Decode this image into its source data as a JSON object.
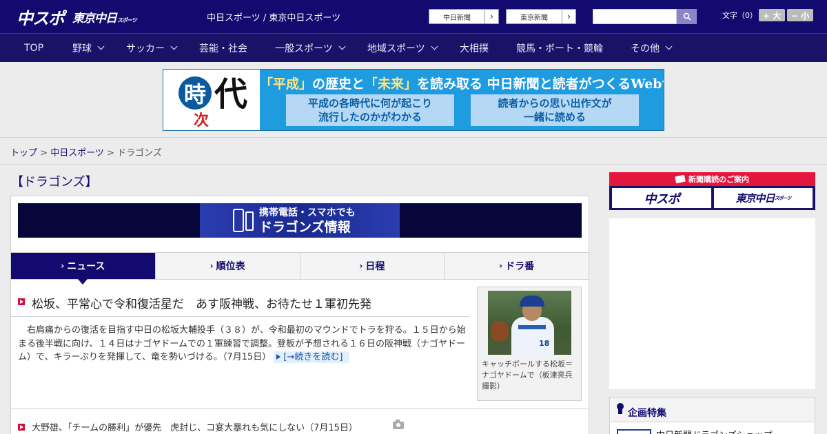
{
  "header": {
    "logo_main": "中スポ",
    "logo_tokyo": "東京中日",
    "logo_tokyo_suffix": "スポーツ",
    "site_title": "中日スポーツ / 東京中日スポーツ",
    "links": [
      "中日新聞",
      "東京新聞"
    ],
    "search_placeholder": "",
    "font_label": "文字（0）",
    "font_bigger": "+ 大",
    "font_smaller": "− 小"
  },
  "nav": [
    {
      "label": "TOP",
      "dropdown": false
    },
    {
      "label": "野球",
      "dropdown": true
    },
    {
      "label": "サッカー",
      "dropdown": true
    },
    {
      "label": "芸能・社会",
      "dropdown": false
    },
    {
      "label": "一般スポーツ",
      "dropdown": true
    },
    {
      "label": "地域スポーツ",
      "dropdown": true
    },
    {
      "label": "大相撲",
      "dropdown": false
    },
    {
      "label": "競馬・ボート・競輪",
      "dropdown": false
    },
    {
      "label": "その他",
      "dropdown": true
    }
  ],
  "banner": {
    "ji": "時",
    "dai": "代",
    "tsugi": "次",
    "headline_parts": [
      "「平成」",
      "の歴史と",
      "「未来」",
      "を読み取る 中日新聞と読者がつくるWebサイト"
    ],
    "box_left": "平成の各時代に何が起こり\n流行したのかがわかる",
    "box_right": "読者からの思い出作文が\n一緒に読める"
  },
  "breadcrumb": {
    "items": [
      "トップ",
      "中日スポーツ",
      "ドラゴンズ"
    ],
    "separator": " > "
  },
  "page_title": "【ドラゴンズ】",
  "mobile_banner": {
    "line1": "携帯電話・スマホでも",
    "line2": "ドラゴンズ情報"
  },
  "tabs": [
    {
      "label": "ニュース",
      "active": true
    },
    {
      "label": "順位表",
      "active": false
    },
    {
      "label": "日程",
      "active": false
    },
    {
      "label": "ドラ番",
      "active": false
    }
  ],
  "lead": {
    "title": "松坂、平常心で令和復活星だ　あす阪神戦、お待たせ１軍初先発",
    "body": "　右肩痛からの復活を目指す中日の松坂大輔投手（３８）が、令和最初のマウンドでトラを狩る。１５日から始まる後半戦に向け、１４日はナゴヤドームでの１軍練習で調整。登板が予想される１６日の阪神戦（ナゴヤドーム）で、キラーぶりを発揮して、竜を勢いづける。（7月15日）",
    "read_more": "[→続きを読む]",
    "photo_caption": "キャッチボールする松坂＝ナゴヤドームで（板津亮兵撮影）",
    "photo_number": "18"
  },
  "news_items": [
    {
      "text": "大野雄、「チームの勝利」が優先　虎封じ、コ宴大暴れも気にしない（7月15日）"
    }
  ],
  "sidebar": {
    "subscribe_title": "新聞購読のご案内",
    "subscribe_logos": [
      "中スポ",
      "東京中日"
    ],
    "subscribe_logo_suffix": "スポーツ",
    "feature_title": "企画特集",
    "feature_item": "中日新聞ドラゴンズショップ"
  },
  "colors": {
    "navy": "#120a6e",
    "accent_red": "#d0103a",
    "banner_blue": "#1f9be0"
  }
}
